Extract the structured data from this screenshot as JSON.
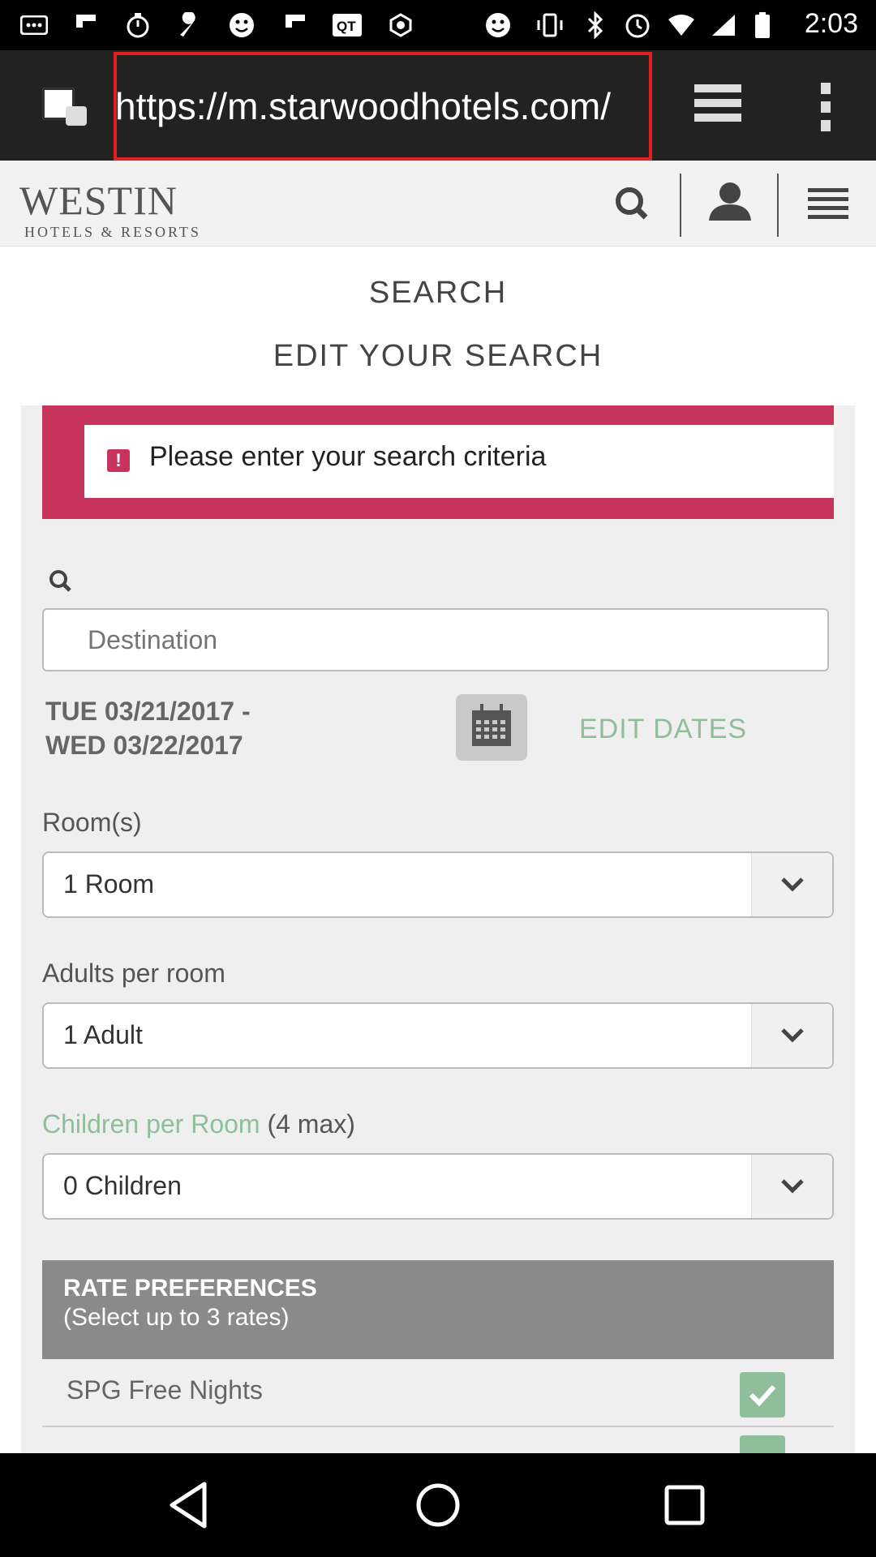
{
  "status_bar": {
    "time": "2:03",
    "icons": [
      "messages-icon",
      "flipboard-icon",
      "timer-icon",
      "wrench-icon",
      "smiley-icon",
      "flipboard-icon",
      "qt-icon",
      "settings-icon",
      "smiley-icon",
      "vibrate-icon",
      "bluetooth-icon",
      "alarm-icon",
      "wifi-icon",
      "signal-icon",
      "battery-icon"
    ]
  },
  "browser": {
    "url": "https://m.starwoodhotels.com/"
  },
  "site_header": {
    "logo_main": "WESTIN",
    "logo_sub": "HOTELS & RESORTS"
  },
  "page": {
    "title": "SEARCH",
    "subtitle": "EDIT YOUR SEARCH",
    "alert": "Please enter your search criteria",
    "destination_placeholder": "Destination",
    "dates_line1": "TUE 03/21/2017 -",
    "dates_line2": "WED 03/22/2017",
    "edit_dates": "EDIT DATES",
    "rooms_label": "Room(s)",
    "rooms_value": "1 Room",
    "adults_label": "Adults per room",
    "adults_value": "1 Adult",
    "children_label": "Children per Room",
    "children_max": "(4 max)",
    "children_value": "0 Children",
    "rate_title": "RATE PREFERENCES",
    "rate_subtitle": "(Select up to 3 rates)",
    "rate_items": [
      {
        "label": "SPG Free Nights",
        "checked": true
      },
      {
        "label": "",
        "checked": true
      }
    ]
  },
  "colors": {
    "alert": "#c8345c",
    "accent_green": "#8fbf9a",
    "rate_header": "#8a8a8a"
  }
}
